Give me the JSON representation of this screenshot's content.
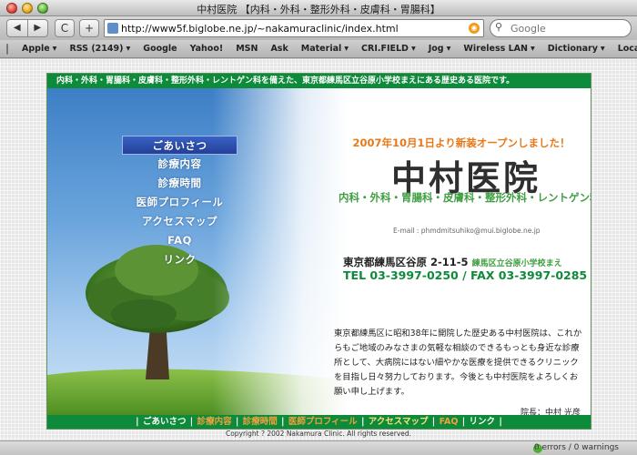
{
  "window": {
    "title": "中村医院 【内科・外科・整形外科・皮膚科・胃腸科】"
  },
  "toolbar": {
    "back_label": "◀",
    "forward_label": "▶",
    "reload_label": "C",
    "add_label": "+",
    "url": "http://www5f.biglobe.ne.jp/~nakamuraclinic/index.html",
    "search_placeholder": "Google"
  },
  "bookmarks": [
    "Apple",
    "RSS (2149)",
    "Google",
    "Yahoo!",
    "MSN",
    "Ask",
    "Material",
    "CRI.FIELD",
    "Jog",
    "Wireless LAN",
    "Dictionary",
    "Local"
  ],
  "site": {
    "top_banner": "内科・外科・胃腸科・皮膚科・整形外科・レントゲン科を備えた、東京都練馬区立谷原小学校まえにある歴史ある医院です。",
    "menu": [
      "ごあいさつ",
      "診療内容",
      "診療時間",
      "医師プロフィール",
      "アクセスマップ",
      "FAQ",
      "リンク"
    ],
    "opening": "2007年10月1日より新装オープンしました！",
    "clinic_name": "中村医院",
    "departments": "内科・外科・胃腸科・皮膚科・整形外科・レントゲン科",
    "email": "E-mail : phmdmitsuhiko@mui.biglobe.ne.jp",
    "address": "東京都練馬区谷原 2-11-5",
    "address_note": "練馬区立谷原小学校まえ",
    "phone": "TEL 03-3997-0250 / FAX 03-3997-0285",
    "intro": "東京都練馬区に昭和38年に開院した歴史ある中村医院は、これからもご地域のみなさまの気軽な相談のできるもっとも身近な診療所として、大病院にはない細やかな医療を提供できるクリニックを目指し日々努力しております。今後とも中村医院をよろしくお願い申し上げます。",
    "director": "院長：中村 光彦",
    "bottom_nav": [
      "ごあいさつ",
      "診療内容",
      "診療時間",
      "医師プロフィール",
      "アクセスマップ",
      "FAQ",
      "リンク"
    ],
    "copyright": "Copyright ? 2002 Nakamura Clinic. All rights reserved."
  },
  "status": {
    "text": "0 errors / 0 warnings"
  },
  "colors": {
    "banner_green": "#0e8a3b",
    "opening_orange": "#e8791a",
    "dept_green": "#3f9e42"
  }
}
